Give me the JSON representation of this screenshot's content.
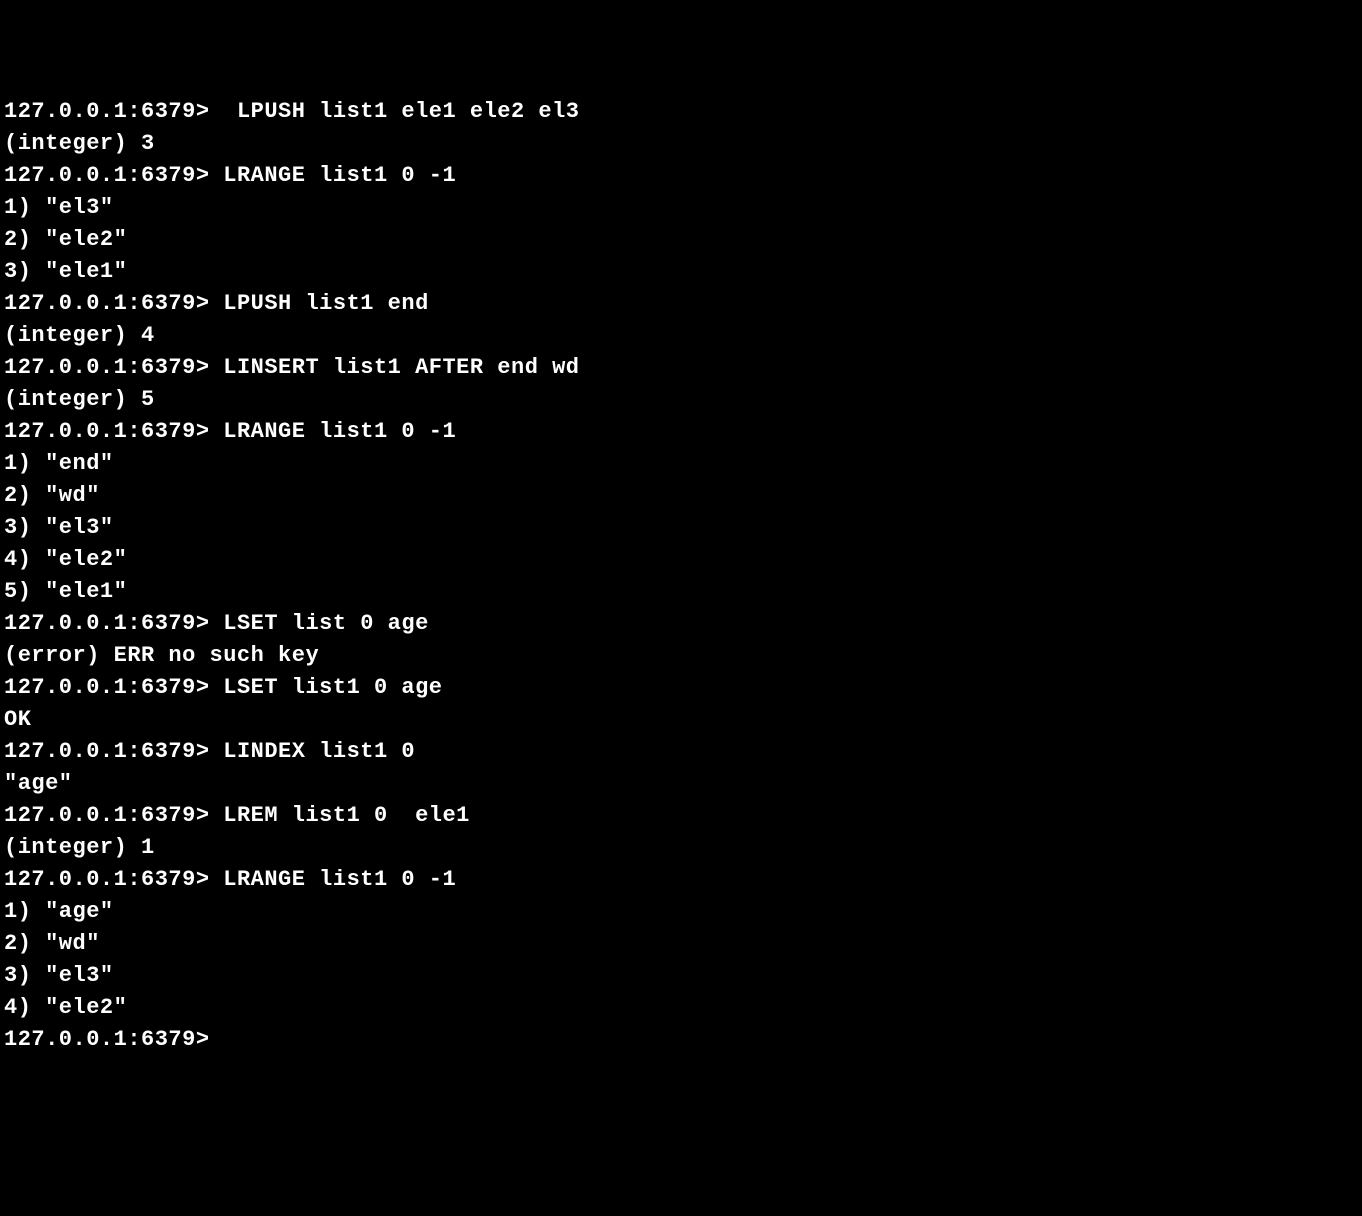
{
  "prompt": "127.0.0.1:6379>",
  "lines": [
    {
      "type": "cmd",
      "text": " LPUSH list1 ele1 ele2 el3"
    },
    {
      "type": "out",
      "text": "(integer) 3"
    },
    {
      "type": "cmd",
      "text": "LRANGE list1 0 -1"
    },
    {
      "type": "out",
      "text": "1) \"el3\""
    },
    {
      "type": "out",
      "text": "2) \"ele2\""
    },
    {
      "type": "out",
      "text": "3) \"ele1\""
    },
    {
      "type": "cmd",
      "text": "LPUSH list1 end"
    },
    {
      "type": "out",
      "text": "(integer) 4"
    },
    {
      "type": "cmd",
      "text": "LINSERT list1 AFTER end wd"
    },
    {
      "type": "out",
      "text": "(integer) 5"
    },
    {
      "type": "cmd",
      "text": "LRANGE list1 0 -1"
    },
    {
      "type": "out",
      "text": "1) \"end\""
    },
    {
      "type": "out",
      "text": "2) \"wd\""
    },
    {
      "type": "out",
      "text": "3) \"el3\""
    },
    {
      "type": "out",
      "text": "4) \"ele2\""
    },
    {
      "type": "out",
      "text": "5) \"ele1\""
    },
    {
      "type": "cmd",
      "text": "LSET list 0 age"
    },
    {
      "type": "out",
      "text": "(error) ERR no such key"
    },
    {
      "type": "cmd",
      "text": "LSET list1 0 age"
    },
    {
      "type": "out",
      "text": "OK"
    },
    {
      "type": "cmd",
      "text": "LINDEX list1 0"
    },
    {
      "type": "out",
      "text": "\"age\""
    },
    {
      "type": "cmd",
      "text": "LREM list1 0  ele1"
    },
    {
      "type": "out",
      "text": "(integer) 1"
    },
    {
      "type": "cmd",
      "text": "LRANGE list1 0 -1"
    },
    {
      "type": "out",
      "text": "1) \"age\""
    },
    {
      "type": "out",
      "text": "2) \"wd\""
    },
    {
      "type": "out",
      "text": "3) \"el3\""
    },
    {
      "type": "out",
      "text": "4) \"ele2\""
    },
    {
      "type": "cmd",
      "text": ""
    }
  ]
}
